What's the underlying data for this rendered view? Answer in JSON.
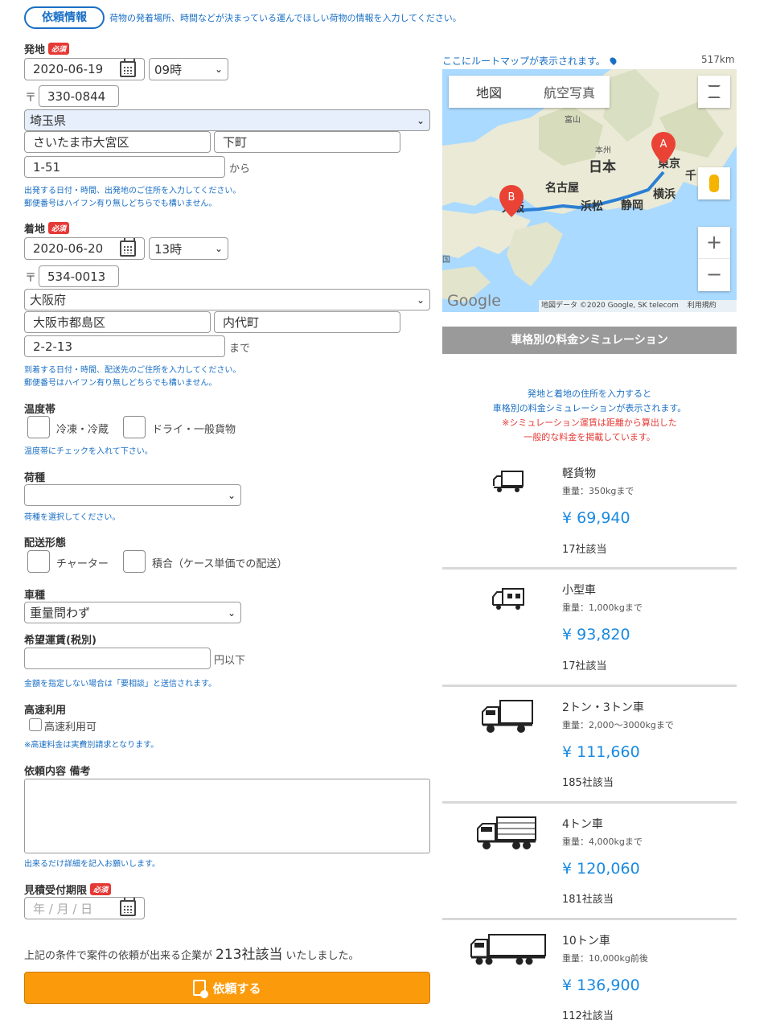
{
  "header": {
    "tab_label": "依頼情報",
    "description": "荷物の発着場所、時間などが決まっている運んでほしい荷物の情報を入力してください。"
  },
  "required_badge": "必須",
  "origin": {
    "label": "発地",
    "date": "2020-06-19",
    "time": "09時",
    "postal_mark": "〒",
    "postal": "330-0844",
    "prefecture": "埼玉県",
    "city": "さいたま市大宮区",
    "town": "下町",
    "address": "1-51",
    "suffix": "から",
    "note1": "出発する日付・時間、出発地のご住所を入力してください。",
    "note2": "郵便番号はハイフン有り無しどちらでも構いません。"
  },
  "destination": {
    "label": "着地",
    "date": "2020-06-20",
    "time": "13時",
    "postal_mark": "〒",
    "postal": "534-0013",
    "prefecture": "大阪府",
    "city": "大阪市都島区",
    "town": "内代町",
    "address": "2-2-13",
    "suffix": "まで",
    "note1": "到着する日付・時間、配送先のご住所を入力してください。",
    "note2": "郵便番号はハイフン有り無しどちらでも構いません。"
  },
  "temperature": {
    "label": "温度帯",
    "option1": "冷凍・冷蔵",
    "option2": "ドライ・一般貨物",
    "note": "温度帯にチェックを入れて下さい。"
  },
  "cargo": {
    "label": "荷種",
    "value": "",
    "note": "荷種を選択してください。"
  },
  "delivery": {
    "label": "配送形態",
    "option1": "チャーター",
    "option2": "積合（ケース単価での配送）"
  },
  "vehicle": {
    "label": "車種",
    "value": "重量問わず"
  },
  "fare": {
    "label": "希望運賃(税別)",
    "value": "",
    "suffix": "円以下",
    "note": "金額を指定しない場合は「要相談」と送信されます。"
  },
  "highway": {
    "label": "高速利用",
    "option": "高速利用可",
    "note": "※高速料金は実費別請求となります。"
  },
  "remarks": {
    "label": "依頼内容 備考",
    "note": "出来るだけ詳細を記入お願いします。"
  },
  "deadline": {
    "label": "見積受付期限",
    "placeholder": "年 / 月 / 日"
  },
  "summary": {
    "prefix": "上記の条件で案件の依頼が出来る企業が",
    "count": "213社該当",
    "suffix": "いたしました。"
  },
  "submit_label": "依頼する",
  "map": {
    "caption": "ここにルートマップが表示されます。",
    "distance": "517km",
    "tab_map": "地図",
    "tab_satellite": "航空写真",
    "marker_a": "A",
    "marker_b": "B",
    "city_labels": [
      "富山",
      "本州",
      "日本",
      "東京",
      "千",
      "名古屋",
      "横浜",
      "浜松",
      "静岡",
      "大阪",
      "国"
    ],
    "zoom_in": "+",
    "zoom_out": "−",
    "google": "Google",
    "attribution": "地図データ ©2020 Google, SK telecom",
    "terms": "利用規約"
  },
  "simulation": {
    "header": "車格別の料金シミュレーション",
    "desc1": "発地と着地の住所を入力すると",
    "desc2": "車格別の料金シミュレーションが表示されます。",
    "warn1": "※シミュレーション運賃は距離から算出した",
    "warn2": "一般的な料金を掲載しています。",
    "colors": {
      "info": "#1a6fc4",
      "warn": "#e53935",
      "price": "#1a8ae0"
    },
    "trucks": [
      {
        "icon": "light-truck-icon",
        "name": "軽貨物",
        "weight": "重量：350kgまで",
        "price": "¥ 69,940",
        "count": "17社該当"
      },
      {
        "icon": "small-truck-icon",
        "name": "小型車",
        "weight": "重量：1,000kgまで",
        "price": "¥ 93,820",
        "count": "17社該当"
      },
      {
        "icon": "2ton-truck-icon",
        "name": "2トン・3トン車",
        "weight": "重量：2,000〜3000kgまで",
        "price": "¥ 111,660",
        "count": "185社該当"
      },
      {
        "icon": "4ton-truck-icon",
        "name": "4トン車",
        "weight": "重量：4,000kgまで",
        "price": "¥ 120,060",
        "count": "181社該当"
      },
      {
        "icon": "10ton-truck-icon",
        "name": "10トン車",
        "weight": "重量：10,000kg前後",
        "price": "¥ 136,900",
        "count": "112社該当"
      }
    ]
  }
}
